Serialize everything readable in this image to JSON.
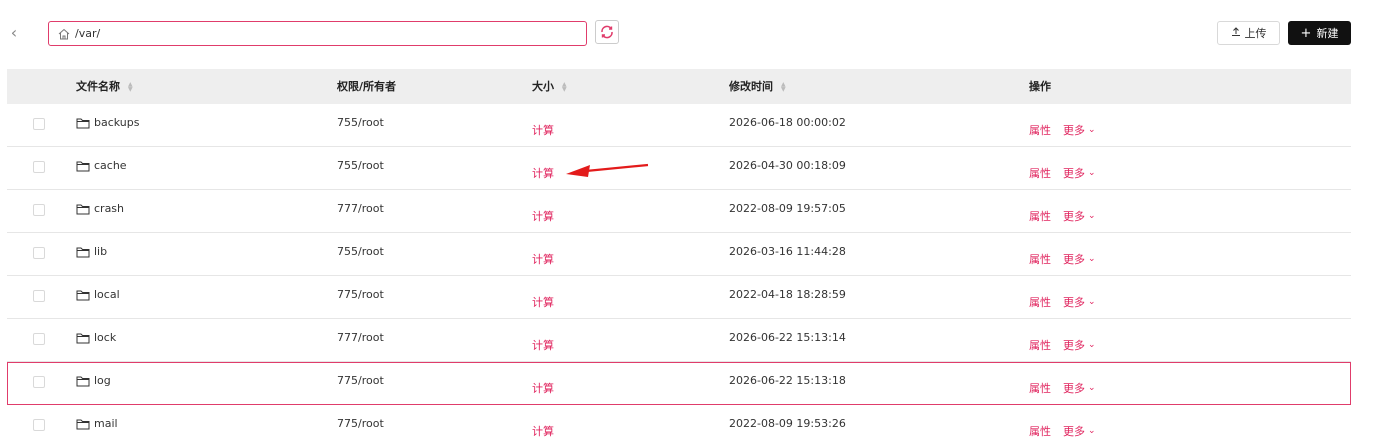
{
  "toolbar": {
    "path_value": "/var/",
    "upload_label": "上传",
    "new_label": "新建"
  },
  "icons": {
    "back": "chevron-left-icon",
    "home": "home-icon",
    "refresh": "refresh-icon",
    "upload": "upload-icon",
    "plus": "plus-icon",
    "folder": "folder-icon",
    "sort": "sort-icon",
    "chevron": "chevron-down-icon",
    "annotation": "red-arrow"
  },
  "colors": {
    "accent": "#e03c6b",
    "link": "#e0245e",
    "header_bg": "#eeeeee",
    "primary_button": "#111111"
  },
  "table": {
    "headers": {
      "name": "文件名称",
      "perm": "权限/所有者",
      "size": "大小",
      "mtime": "修改时间",
      "ops": "操作"
    },
    "rows": [
      {
        "name": "backups",
        "perm": "755/root",
        "size": "计算",
        "mtime": "2026-06-18 00:00:02",
        "prop": "属性",
        "more": "更多"
      },
      {
        "name": "cache",
        "perm": "755/root",
        "size": "计算",
        "mtime": "2026-04-30 00:18:09",
        "prop": "属性",
        "more": "更多"
      },
      {
        "name": "crash",
        "perm": "777/root",
        "size": "计算",
        "mtime": "2022-08-09 19:57:05",
        "prop": "属性",
        "more": "更多"
      },
      {
        "name": "lib",
        "perm": "755/root",
        "size": "计算",
        "mtime": "2026-03-16 11:44:28",
        "prop": "属性",
        "more": "更多"
      },
      {
        "name": "local",
        "perm": "775/root",
        "size": "计算",
        "mtime": "2022-04-18 18:28:59",
        "prop": "属性",
        "more": "更多"
      },
      {
        "name": "lock",
        "perm": "777/root",
        "size": "计算",
        "mtime": "2026-06-22 15:13:14",
        "prop": "属性",
        "more": "更多"
      },
      {
        "name": "log",
        "perm": "775/root",
        "size": "计算",
        "mtime": "2026-06-22 15:13:18",
        "prop": "属性",
        "more": "更多"
      },
      {
        "name": "mail",
        "perm": "775/root",
        "size": "计算",
        "mtime": "2022-08-09 19:53:26",
        "prop": "属性",
        "more": "更多"
      }
    ]
  }
}
